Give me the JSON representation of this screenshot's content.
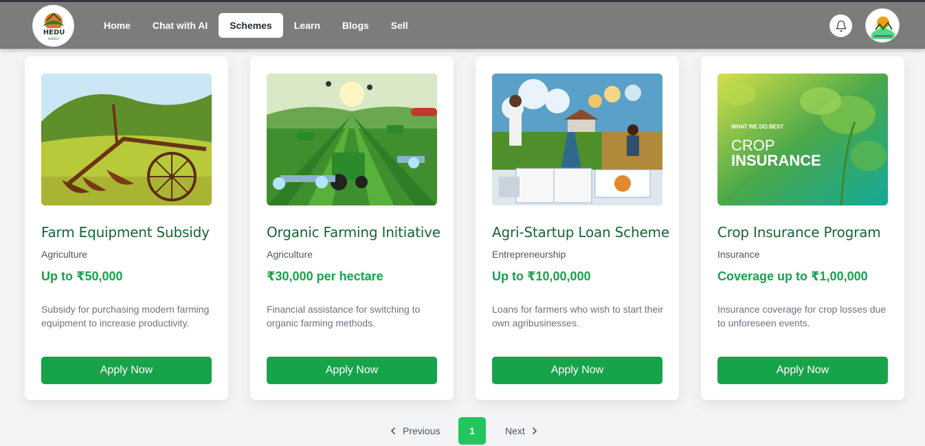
{
  "brand": {
    "logo_text": "HEDU",
    "logo_sub": "KHEDUT"
  },
  "nav": {
    "items": [
      {
        "label": "Home"
      },
      {
        "label": "Chat with AI"
      },
      {
        "label": "Schemes"
      },
      {
        "label": "Learn"
      },
      {
        "label": "Blogs"
      },
      {
        "label": "Sell"
      }
    ],
    "active": "Schemes"
  },
  "icons": {
    "notifications": "bell-icon",
    "profile": "avatar"
  },
  "colors": {
    "accent": "#16a34a",
    "title": "#166534",
    "navbar": "#7c7c7c"
  },
  "cards": [
    {
      "title": "Farm Equipment Subsidy",
      "category": "Agriculture",
      "amount": "Up to ₹50,000",
      "description": "Subsidy for purchasing modern farming equipment to increase productivity.",
      "button": "Apply Now"
    },
    {
      "title": "Organic Farming Initiative",
      "category": "Agriculture",
      "amount": "₹30,000 per hectare",
      "description": "Financial assistance for switching to organic farming methods.",
      "button": "Apply Now"
    },
    {
      "title": "Agri-Startup Loan Scheme",
      "category": "Entrepreneurship",
      "amount": "Up to ₹10,00,000",
      "description": "Loans for farmers who wish to start their own agribusinesses.",
      "button": "Apply Now"
    },
    {
      "title": "Crop Insurance Program",
      "category": "Insurance",
      "amount": "Coverage up to ₹1,00,000",
      "description": "Insurance coverage for crop losses due to unforeseen events.",
      "button": "Apply Now",
      "image_text": {
        "tag": "WHAT WE DO BEST",
        "line1": "CROP",
        "line2": "INSURANCE"
      }
    }
  ],
  "pagination": {
    "previous": "Previous",
    "current": "1",
    "next": "Next"
  }
}
